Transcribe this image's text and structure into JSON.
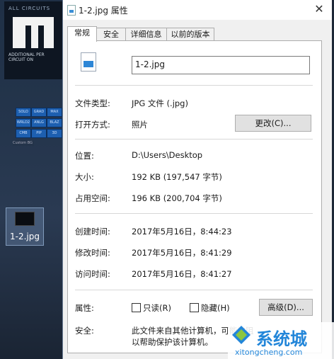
{
  "desktop": {
    "banner_line1": "ALL CIRCUITS",
    "banner_line2": "ADDITIONAL PER CIRCUIT ON",
    "grid_cells": [
      "SOLO",
      "GRAD",
      "MAX",
      "WRLD2",
      "ANLG",
      "BLAZ",
      "CMB",
      "PIP",
      "3D"
    ],
    "grid_label": "Custom BG",
    "file_icon_label": "1-2.jpg"
  },
  "window": {
    "title": "1-2.jpg 属性",
    "close_glyph": "✕",
    "tabs": [
      {
        "label": "常规",
        "active": true
      },
      {
        "label": "安全",
        "active": false
      },
      {
        "label": "详细信息",
        "active": false
      },
      {
        "label": "以前的版本",
        "active": false
      }
    ],
    "filename": "1-2.jpg",
    "file_type_label": "文件类型:",
    "file_type_value": "JPG 文件 (.jpg)",
    "open_with_label": "打开方式:",
    "open_with_value": "照片",
    "change_button": "更改(C)...",
    "location_label": "位置:",
    "location_value": "D:\\Users\\Desktop",
    "size_label": "大小:",
    "size_value": "192 KB (197,547 字节)",
    "size_on_disk_label": "占用空间:",
    "size_on_disk_value": "196 KB (200,704 字节)",
    "created_label": "创建时间:",
    "created_value": "2017年5月16日，8:44:23",
    "modified_label": "修改时间:",
    "modified_value": "2017年5月16日，8:41:29",
    "accessed_label": "访问时间:",
    "accessed_value": "2017年5月16日，8:41:27",
    "attributes_label": "属性:",
    "readonly_label": "只读(R)",
    "hidden_label": "隐藏(H)",
    "advanced_button": "高级(D)...",
    "security_label": "安全:",
    "security_text_line1": "此文件来自其他计算机，可能被阻",
    "security_text_line2": "以帮助保护该计算机。"
  },
  "watermark": {
    "brand": "系统城",
    "url": "xitongcheng.com"
  },
  "colors": {
    "accent": "#2386d9",
    "desktop_bg": "#1c2736",
    "window_bg": "#f0f0f0"
  }
}
